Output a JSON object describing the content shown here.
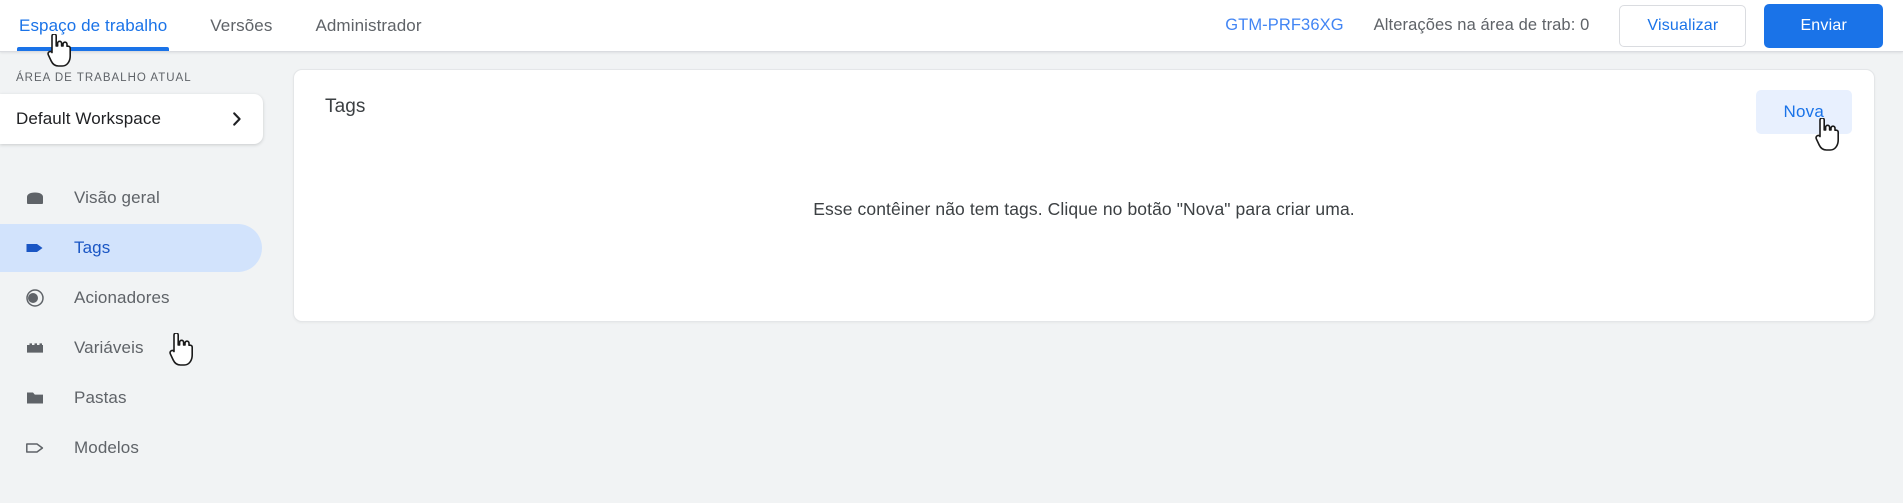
{
  "topbar": {
    "tabs": [
      {
        "label": "Espaço de trabalho",
        "active": true
      },
      {
        "label": "Versões",
        "active": false
      },
      {
        "label": "Administrador",
        "active": false
      }
    ],
    "container_id": "GTM-PRF36XG",
    "changes_text": "Alterações na área de trab: 0",
    "preview_button": "Visualizar",
    "submit_button": "Enviar",
    "accent_color": "#1a73e8",
    "link_color": "#4285f4"
  },
  "sidebar": {
    "workspace_label": "ÁREA DE TRABALHO ATUAL",
    "workspace_name": "Default Workspace",
    "chevron_icon": "chevron-right-icon",
    "items": [
      {
        "label": "Visão geral",
        "icon": "overview-box-icon",
        "active": false
      },
      {
        "label": "Tags",
        "icon": "tag-filled-icon",
        "active": true
      },
      {
        "label": "Acionadores",
        "icon": "trigger-circle-icon",
        "active": false
      },
      {
        "label": "Variáveis",
        "icon": "variables-brick-icon",
        "active": false
      },
      {
        "label": "Pastas",
        "icon": "folder-icon",
        "active": false
      },
      {
        "label": "Modelos",
        "icon": "template-tag-outline-icon",
        "active": false
      }
    ],
    "active_bg": "#d2e3fc",
    "active_fg": "#1a56c4"
  },
  "main": {
    "card_title": "Tags",
    "new_button": "Nova",
    "empty_message": "Esse contêiner não tem tags. Clique no botão \"Nova\" para criar uma.",
    "new_button_bg": "#e8f0fe",
    "new_button_fg": "#1a73e8"
  },
  "cursors": [
    {
      "name": "pointer-over-workspace-tab"
    },
    {
      "name": "pointer-over-tags-nav"
    },
    {
      "name": "pointer-over-nova-button"
    }
  ]
}
